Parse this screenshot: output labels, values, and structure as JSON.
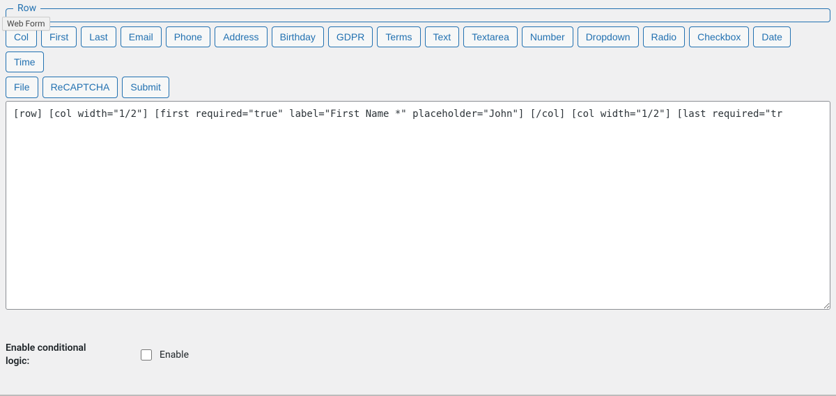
{
  "fieldset": {
    "legend": "Row"
  },
  "tooltip": "Web Form",
  "buttons_row1": [
    "Col",
    "First",
    "Last",
    "Email",
    "Phone",
    "Address",
    "Birthday",
    "GDPR",
    "Terms",
    "Text",
    "Textarea",
    "Number",
    "Dropdown",
    "Radio",
    "Checkbox",
    "Date",
    "Time"
  ],
  "buttons_row2": [
    "File",
    "ReCAPTCHA",
    "Submit"
  ],
  "textarea_value": "[row] [col width=\"1/2\"] [first required=\"true\" label=\"First Name *\" placeholder=\"John\"] [/col] [col width=\"1/2\"] [last required=\"tr",
  "conditional": {
    "label": "Enable conditional logic:",
    "checkbox_label": "Enable",
    "checked": false
  }
}
